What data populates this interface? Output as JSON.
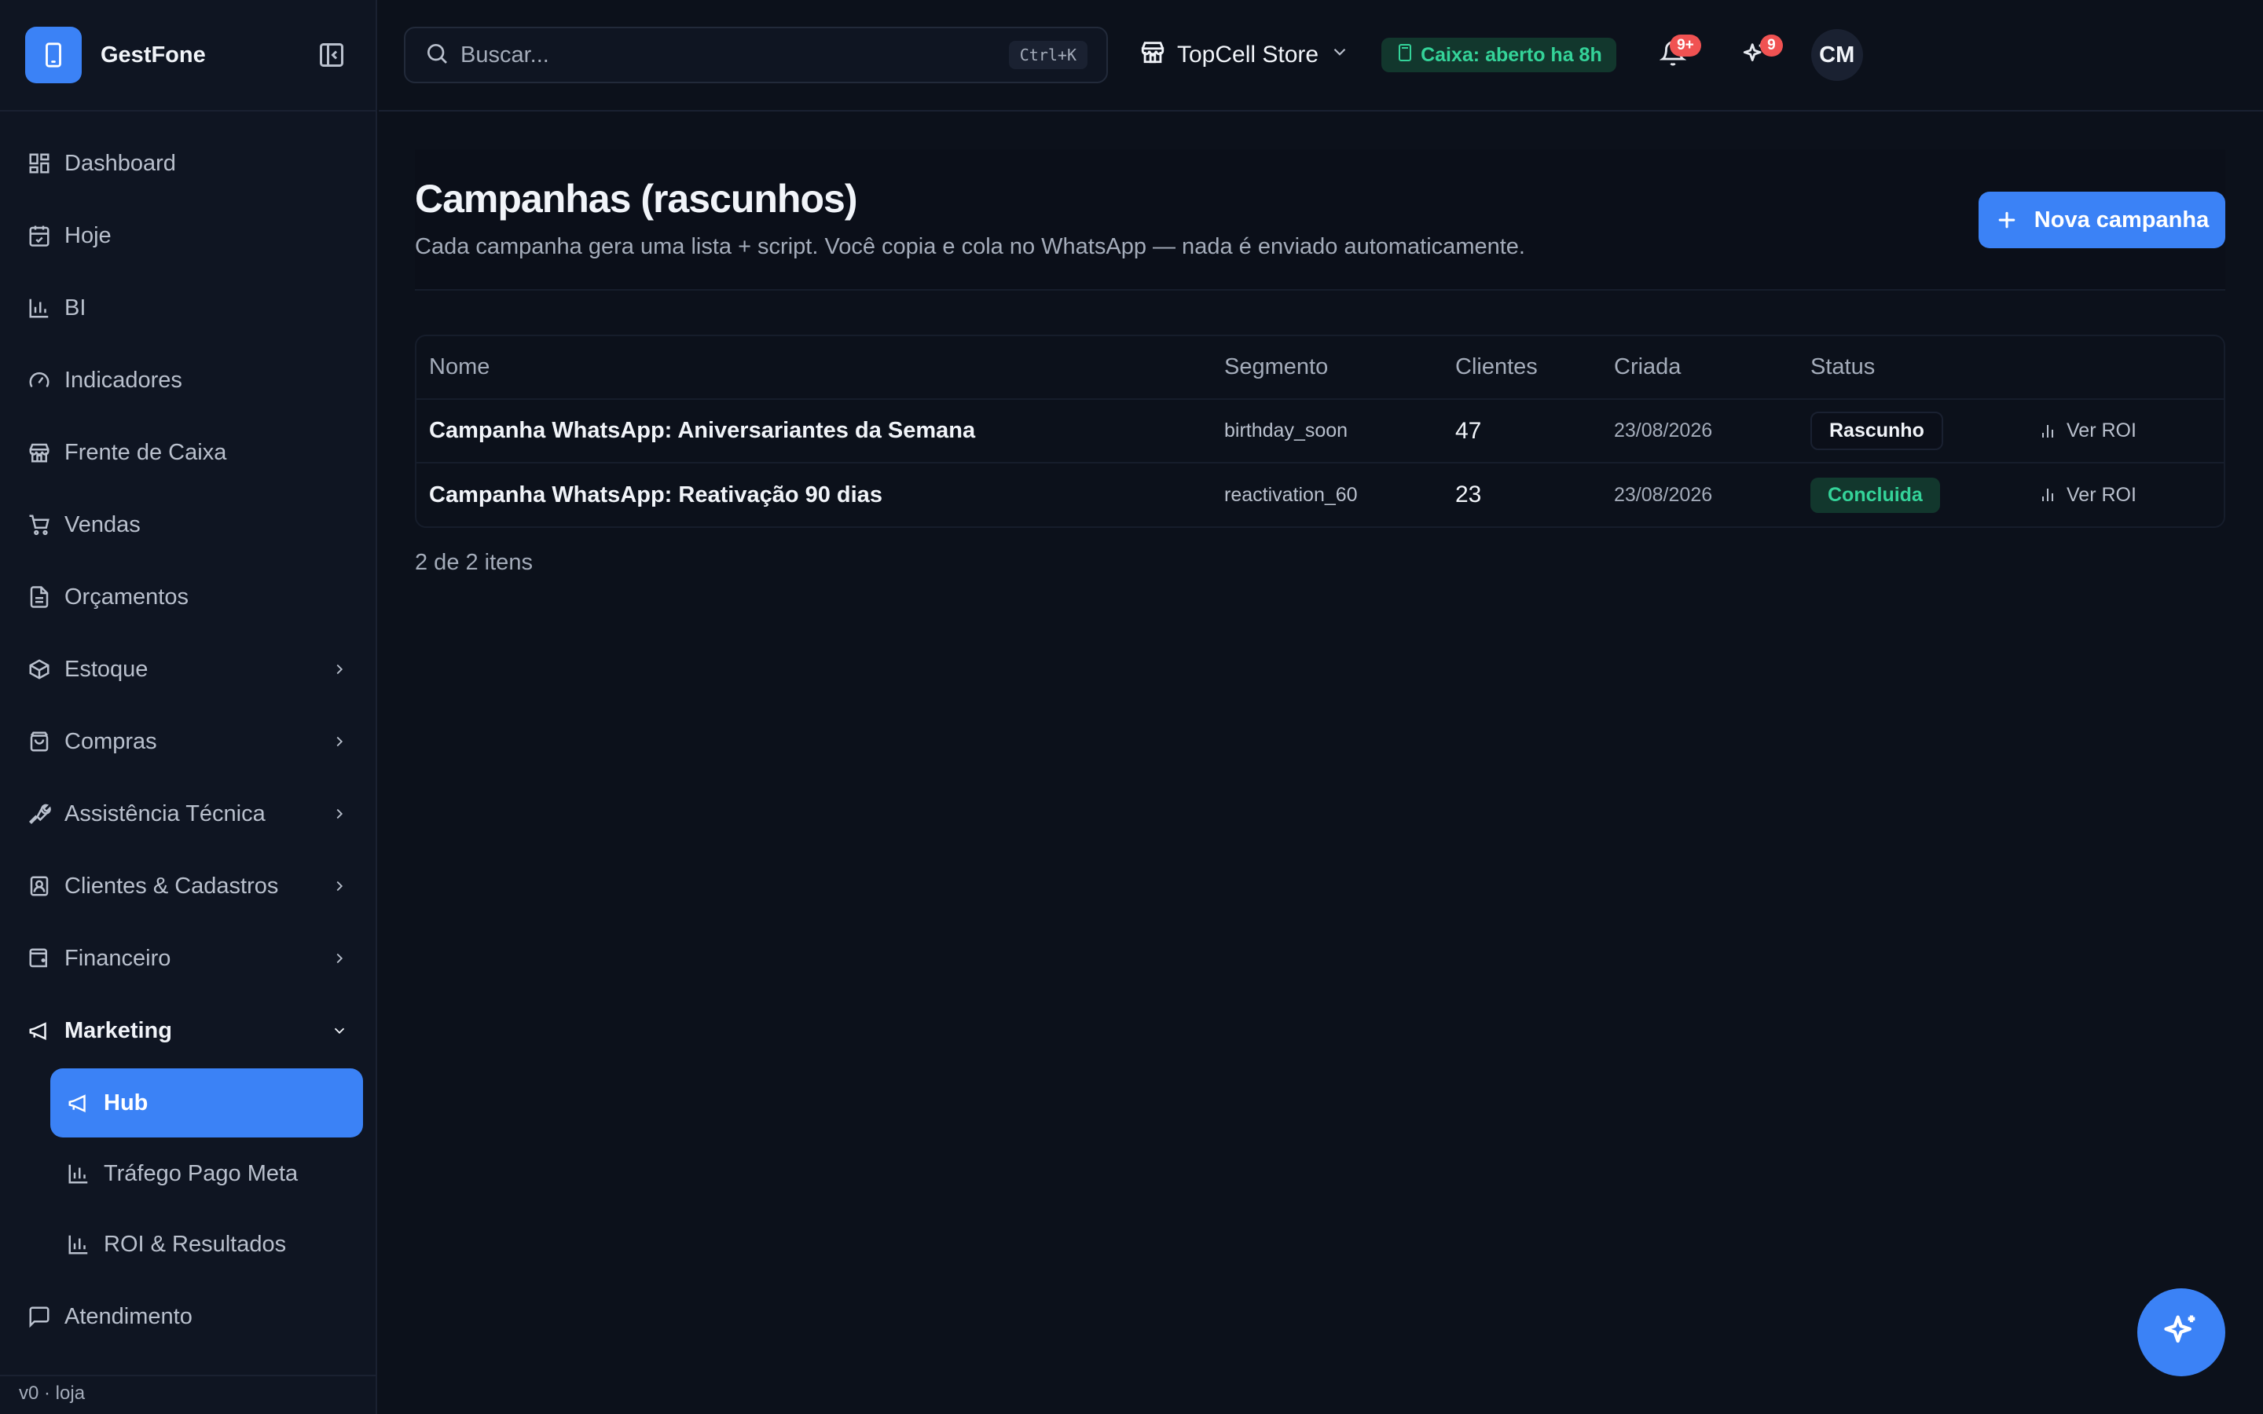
{
  "app": {
    "name": "GestFone",
    "version": "v0 · loja"
  },
  "sidebar": {
    "items": [
      {
        "label": "Dashboard",
        "icon": "dashboard-icon"
      },
      {
        "label": "Hoje",
        "icon": "calendar-icon"
      },
      {
        "label": "BI",
        "icon": "bar-chart-icon"
      },
      {
        "label": "Indicadores",
        "icon": "gauge-icon"
      },
      {
        "label": "Frente de Caixa",
        "icon": "store-icon"
      },
      {
        "label": "Vendas",
        "icon": "cart-icon"
      },
      {
        "label": "Orçamentos",
        "icon": "file-icon"
      },
      {
        "label": "Estoque",
        "icon": "box-icon"
      },
      {
        "label": "Compras",
        "icon": "bag-icon"
      },
      {
        "label": "Assistência Técnica",
        "icon": "wrench-icon"
      },
      {
        "label": "Clientes & Cadastros",
        "icon": "contact-icon"
      },
      {
        "label": "Financeiro",
        "icon": "wallet-icon"
      },
      {
        "label": "Marketing",
        "icon": "megaphone-icon"
      },
      {
        "label": "Atendimento",
        "icon": "chat-icon"
      }
    ],
    "marketing_sub": [
      {
        "label": "Hub",
        "icon": "megaphone-icon"
      },
      {
        "label": "Tráfego Pago Meta",
        "icon": "bar-chart-icon"
      },
      {
        "label": "ROI & Resultados",
        "icon": "bar-chart-icon"
      }
    ]
  },
  "header": {
    "search_placeholder": "Buscar...",
    "shortcut": "Ctrl+K",
    "store": "TopCell Store",
    "caixa_status": "Caixa: aberto ha 8h",
    "notifications_badge": "9+",
    "ai_badge": "9",
    "avatar_initials": "CM"
  },
  "page": {
    "title": "Campanhas (rascunhos)",
    "subtitle": "Cada campanha gera uma lista + script. Você copia e cola no WhatsApp — nada é enviado automaticamente.",
    "new_button": "Nova campanha",
    "columns": {
      "name": "Nome",
      "segment": "Segmento",
      "clients": "Clientes",
      "created": "Criada",
      "status": "Status"
    },
    "rows": [
      {
        "name": "Campanha WhatsApp: Aniversariantes da Semana",
        "segment": "birthday_soon",
        "clients": "47",
        "created": "23/08/2026",
        "status": "Rascunho",
        "action": "Ver ROI"
      },
      {
        "name": "Campanha WhatsApp: Reativação 90 dias",
        "segment": "reactivation_60",
        "clients": "23",
        "created": "23/08/2026",
        "status": "Concluida",
        "action": "Ver ROI"
      }
    ],
    "count_text": "2 de 2 itens"
  },
  "colors": {
    "accent": "#3b82f6",
    "success": "#34d399",
    "background": "#0c111b",
    "sidebar": "#0f1522"
  }
}
